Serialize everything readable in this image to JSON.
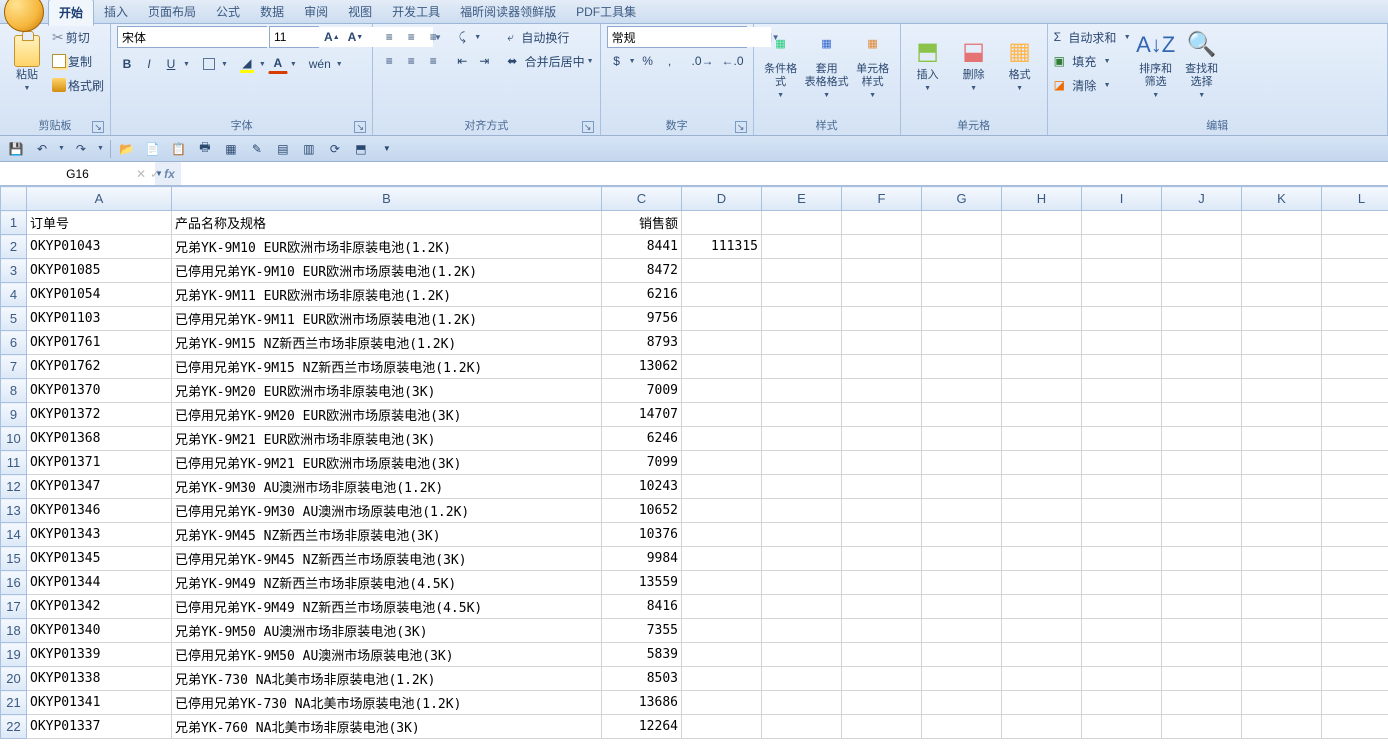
{
  "tabs": {
    "items": [
      "开始",
      "插入",
      "页面布局",
      "公式",
      "数据",
      "审阅",
      "视图",
      "开发工具",
      "福昕阅读器领鲜版",
      "PDF工具集"
    ],
    "active": 0
  },
  "ribbon": {
    "clipboard": {
      "label": "剪贴板",
      "paste": "粘贴",
      "cut": "剪切",
      "copy": "复制",
      "format_painter": "格式刷"
    },
    "font": {
      "label": "字体",
      "name": "宋体",
      "size": "11",
      "bold": "B",
      "italic": "I",
      "underline": "U"
    },
    "alignment": {
      "label": "对齐方式",
      "wrap": "自动换行",
      "merge": "合并后居中"
    },
    "number": {
      "label": "数字",
      "format": "常规"
    },
    "styles": {
      "label": "样式",
      "cond": "条件格式",
      "table": "套用\n表格格式",
      "cell": "单元格\n样式"
    },
    "cells": {
      "label": "单元格",
      "insert": "插入",
      "delete": "删除",
      "format": "格式"
    },
    "editing": {
      "label": "编辑",
      "sum": "自动求和",
      "fill": "填充",
      "clear": "清除",
      "sort": "排序和\n筛选",
      "find": "查找和\n选择"
    }
  },
  "name_box": "G16",
  "formula": "",
  "columns": [
    "A",
    "B",
    "C",
    "D",
    "E",
    "F",
    "G",
    "H",
    "I",
    "J",
    "K",
    "L"
  ],
  "headers": {
    "A": "订单号",
    "B": "产品名称及规格",
    "C": "销售额"
  },
  "rows": [
    {
      "n": 1,
      "A": "订单号",
      "B": "产品名称及规格",
      "C": "销售额",
      "D": ""
    },
    {
      "n": 2,
      "A": "OKYP01043",
      "B": "兄弟YK-9M10 EUR欧洲市场非原装电池(1.2K)",
      "C": "8441",
      "D": "111315"
    },
    {
      "n": 3,
      "A": "OKYP01085",
      "B": "已停用兄弟YK-9M10 EUR欧洲市场原装电池(1.2K)",
      "C": "8472",
      "D": ""
    },
    {
      "n": 4,
      "A": "OKYP01054",
      "B": "兄弟YK-9M11 EUR欧洲市场非原装电池(1.2K)",
      "C": "6216",
      "D": ""
    },
    {
      "n": 5,
      "A": "OKYP01103",
      "B": "已停用兄弟YK-9M11 EUR欧洲市场原装电池(1.2K)",
      "C": "9756",
      "D": ""
    },
    {
      "n": 6,
      "A": "OKYP01761",
      "B": "兄弟YK-9M15 NZ新西兰市场非原装电池(1.2K)",
      "C": "8793",
      "D": ""
    },
    {
      "n": 7,
      "A": "OKYP01762",
      "B": "已停用兄弟YK-9M15 NZ新西兰市场原装电池(1.2K)",
      "C": "13062",
      "D": ""
    },
    {
      "n": 8,
      "A": "OKYP01370",
      "B": "兄弟YK-9M20 EUR欧洲市场非原装电池(3K)",
      "C": "7009",
      "D": ""
    },
    {
      "n": 9,
      "A": "OKYP01372",
      "B": "已停用兄弟YK-9M20 EUR欧洲市场原装电池(3K)",
      "C": "14707",
      "D": ""
    },
    {
      "n": 10,
      "A": "OKYP01368",
      "B": "兄弟YK-9M21 EUR欧洲市场非原装电池(3K)",
      "C": "6246",
      "D": ""
    },
    {
      "n": 11,
      "A": "OKYP01371",
      "B": "已停用兄弟YK-9M21 EUR欧洲市场原装电池(3K)",
      "C": "7099",
      "D": ""
    },
    {
      "n": 12,
      "A": "OKYP01347",
      "B": "兄弟YK-9M30 AU澳洲市场非原装电池(1.2K)",
      "C": "10243",
      "D": ""
    },
    {
      "n": 13,
      "A": "OKYP01346",
      "B": "已停用兄弟YK-9M30 AU澳洲市场原装电池(1.2K)",
      "C": "10652",
      "D": ""
    },
    {
      "n": 14,
      "A": "OKYP01343",
      "B": "兄弟YK-9M45 NZ新西兰市场非原装电池(3K)",
      "C": "10376",
      "D": ""
    },
    {
      "n": 15,
      "A": "OKYP01345",
      "B": "已停用兄弟YK-9M45 NZ新西兰市场原装电池(3K)",
      "C": "9984",
      "D": ""
    },
    {
      "n": 16,
      "A": "OKYP01344",
      "B": "兄弟YK-9M49 NZ新西兰市场非原装电池(4.5K)",
      "C": "13559",
      "D": ""
    },
    {
      "n": 17,
      "A": "OKYP01342",
      "B": "已停用兄弟YK-9M49 NZ新西兰市场原装电池(4.5K)",
      "C": "8416",
      "D": ""
    },
    {
      "n": 18,
      "A": "OKYP01340",
      "B": "兄弟YK-9M50 AU澳洲市场非原装电池(3K)",
      "C": "7355",
      "D": ""
    },
    {
      "n": 19,
      "A": "OKYP01339",
      "B": "已停用兄弟YK-9M50 AU澳洲市场原装电池(3K)",
      "C": "5839",
      "D": ""
    },
    {
      "n": 20,
      "A": "OKYP01338",
      "B": "兄弟YK-730 NA北美市场非原装电池(1.2K)",
      "C": "8503",
      "D": ""
    },
    {
      "n": 21,
      "A": "OKYP01341",
      "B": "已停用兄弟YK-730 NA北美市场原装电池(1.2K)",
      "C": "13686",
      "D": ""
    },
    {
      "n": 22,
      "A": "OKYP01337",
      "B": "兄弟YK-760 NA北美市场非原装电池(3K)",
      "C": "12264",
      "D": ""
    }
  ]
}
